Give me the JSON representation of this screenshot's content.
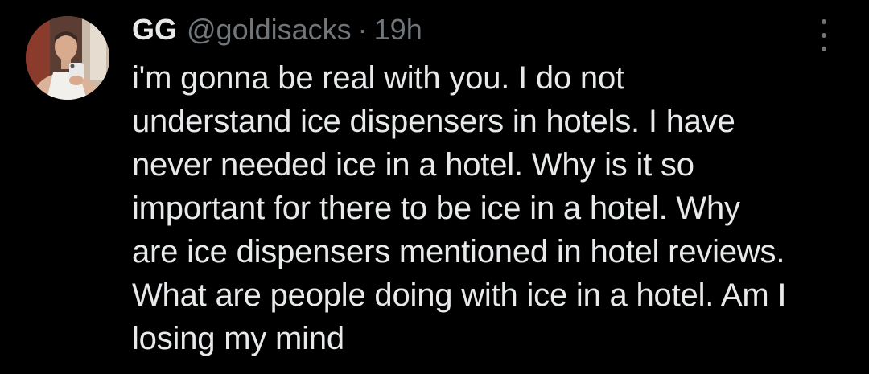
{
  "tweet": {
    "display_name": "GG",
    "handle": "@goldisacks",
    "separator": "·",
    "time": "19h",
    "more_icon": "more-vertical-icon",
    "text": "i'm gonna be real with you. I do not\nunderstand ice dispensers in hotels. I have\nnever needed ice in a hotel. Why is it so\nimportant for there to be ice in a hotel. Why\nare ice dispensers mentioned in hotel reviews.\nWhat are people doing with ice in a hotel. Am I\nlosing my mind"
  },
  "colors": {
    "background": "#000000",
    "primary_text": "#e7e9ea",
    "secondary_text": "#71767b"
  }
}
